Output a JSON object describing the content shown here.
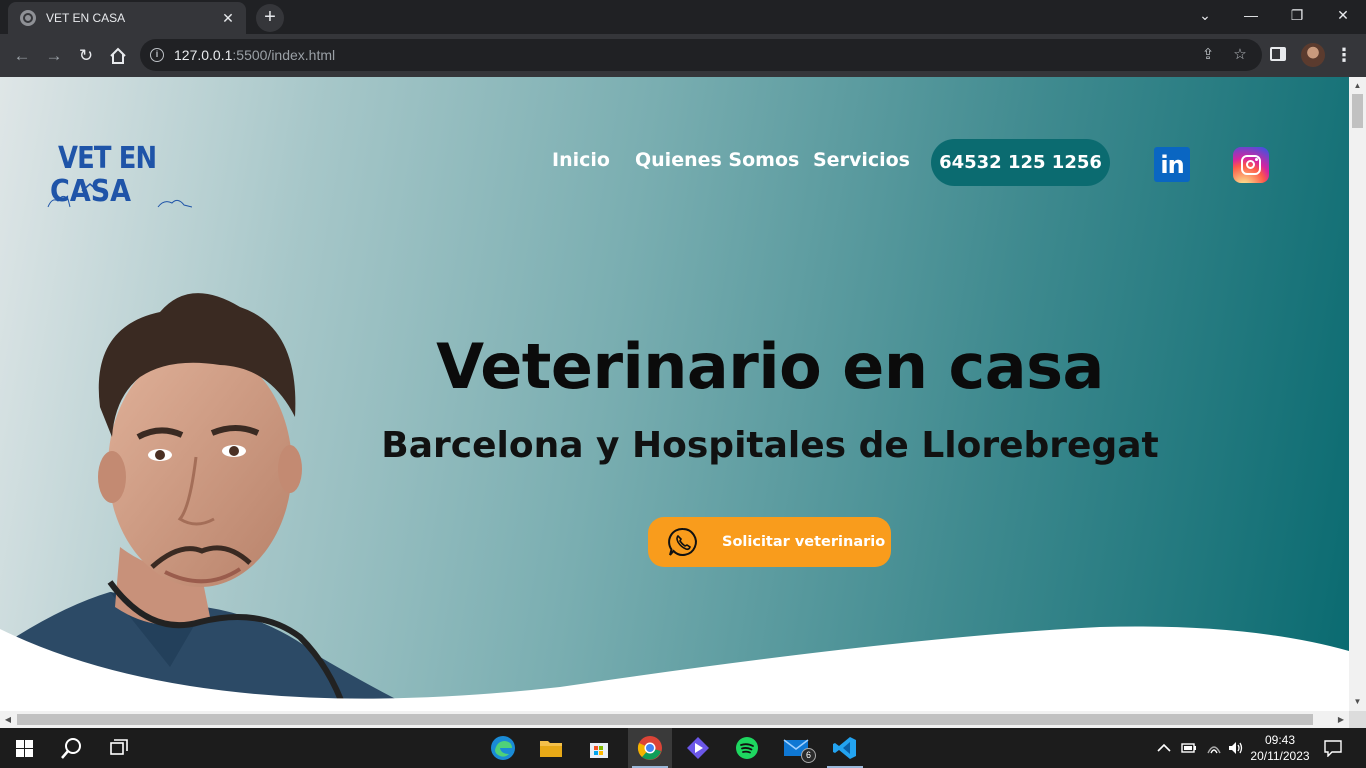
{
  "browser": {
    "tab_title": "VET EN CASA",
    "tab_close": "✕",
    "new_tab": "+",
    "url_host": "127.0.0.1",
    "url_rest": ":5500/index.html",
    "window_controls": {
      "dropdown": "⌄",
      "minimize": "—",
      "restore": "❐",
      "close": "✕"
    }
  },
  "page": {
    "logo": {
      "line1": "VET EN",
      "line2": "CASA"
    },
    "nav": [
      {
        "label": "Inicio"
      },
      {
        "label": "Quienes Somos"
      },
      {
        "label": "Servicios"
      }
    ],
    "phone": "64532 125 1256",
    "social": {
      "linkedin": "in"
    },
    "hero": {
      "title": "Veterinario en casa",
      "subtitle": "Barcelona y Hospitales de Llorebregat",
      "cta": "Solicitar veterinario"
    },
    "colors": {
      "accent_teal": "#0b6b70",
      "cta_orange": "#f99c1c",
      "logo_blue": "#1f54a8"
    }
  },
  "taskbar": {
    "mail_badge": "6",
    "time": "09:43",
    "date": "20/11/2023"
  }
}
